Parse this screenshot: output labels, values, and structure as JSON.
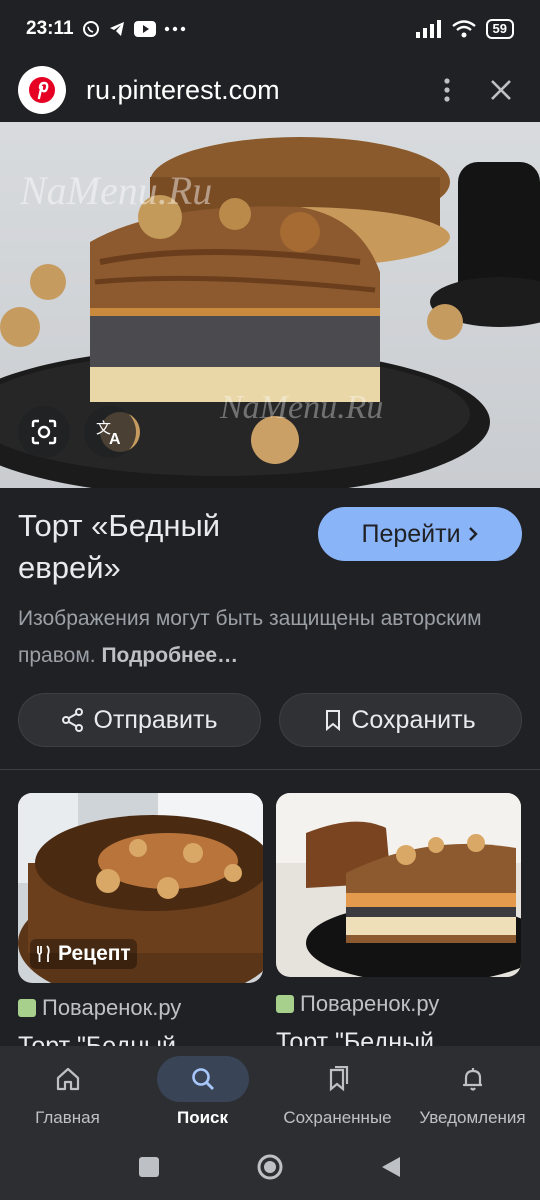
{
  "status": {
    "time": "23:11",
    "battery": "59",
    "icons": [
      "whatsapp-icon",
      "telegram-icon",
      "youtube-icon",
      "more-dots-icon",
      "signal-icon",
      "wifi-icon"
    ]
  },
  "header": {
    "site_icon": "pinterest-logo",
    "url": "ru.pinterest.com"
  },
  "result": {
    "title": "Торт «Бедный еврей»",
    "visit_label": "Перейти",
    "copyright_text": "Изображения могут быть защищены авторским правом.",
    "more_link": "Подробнее…",
    "share_label": "Отправить",
    "save_label": "Сохранить",
    "hero_watermark": "NaMenu.Ru"
  },
  "related": [
    {
      "badge": "Рецепт",
      "source": "Поваренок.ру",
      "title": "Торт \"Бедный"
    },
    {
      "source": "Поваренок.ру",
      "title": "Торт \"Бедный ..."
    }
  ],
  "nav": {
    "items": [
      {
        "label": "Главная",
        "icon": "home-icon",
        "active": false
      },
      {
        "label": "Поиск",
        "icon": "search-icon",
        "active": true
      },
      {
        "label": "Сохраненные",
        "icon": "bookmarks-icon",
        "active": false
      },
      {
        "label": "Уведомления",
        "icon": "bell-icon",
        "active": false
      }
    ]
  },
  "colors": {
    "background": "#202124",
    "accent": "#8ab4f8",
    "pinterest": "#e60023"
  }
}
